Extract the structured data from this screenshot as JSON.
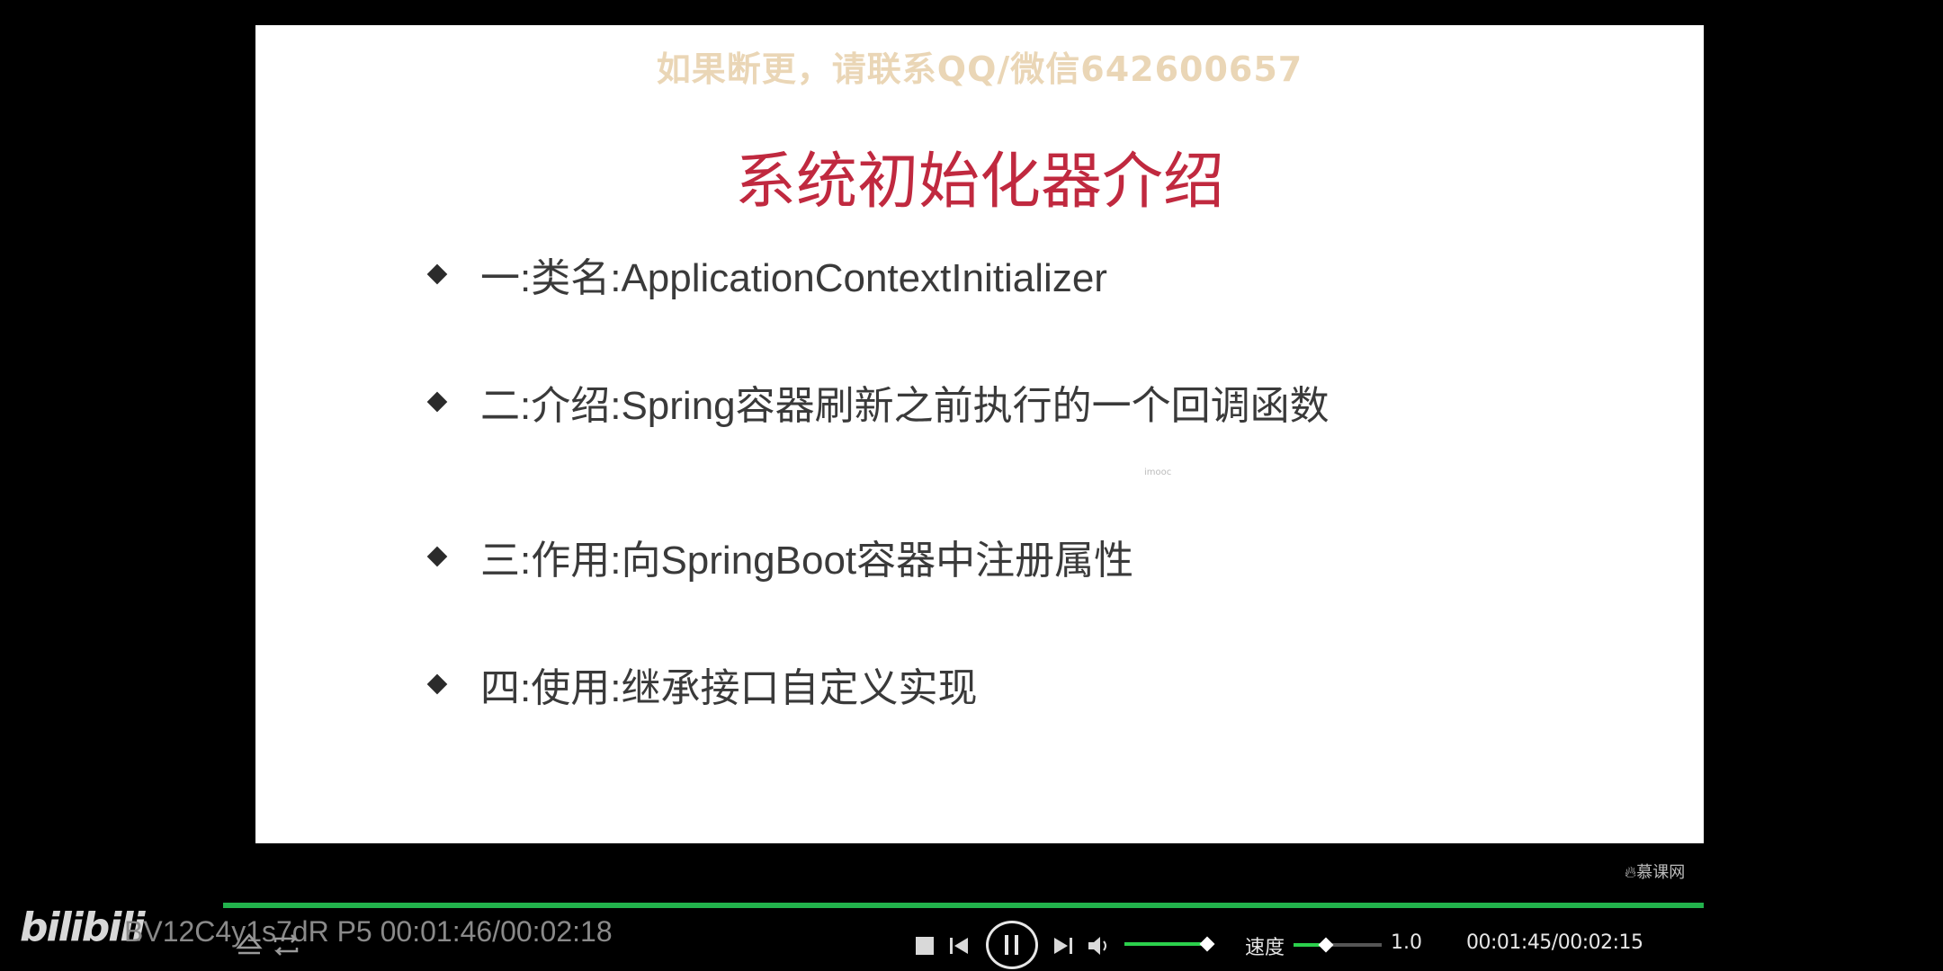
{
  "slide": {
    "watermark": "如果断更，请联系QQ/微信642600657",
    "title": "系统初始化器介绍",
    "bullets": [
      "一:类名:ApplicationContextInitializer",
      "二:介绍:Spring容器刷新之前执行的一个回调函数",
      "三:作用:向SpringBoot容器中注册属性",
      "四:使用:继承接口自定义实现"
    ],
    "tiny_logo": "imooc",
    "mooc_logo": "慕课网"
  },
  "overlay": {
    "bili_logo": "bilibili",
    "video_info": "BV12C4y1s7dR P5 00:01:46/00:02:18"
  },
  "controls": {
    "speed_label": "速度",
    "speed_value": "1.0",
    "time_display": "00:01:45/00:02:15",
    "progress_fraction": 1.0,
    "volume_fraction": 1.0,
    "speed_slider_fraction": 0.35
  },
  "colors": {
    "accent_green": "#2bd04c",
    "title_red": "#c0293f",
    "watermark": "#ead6b6"
  }
}
